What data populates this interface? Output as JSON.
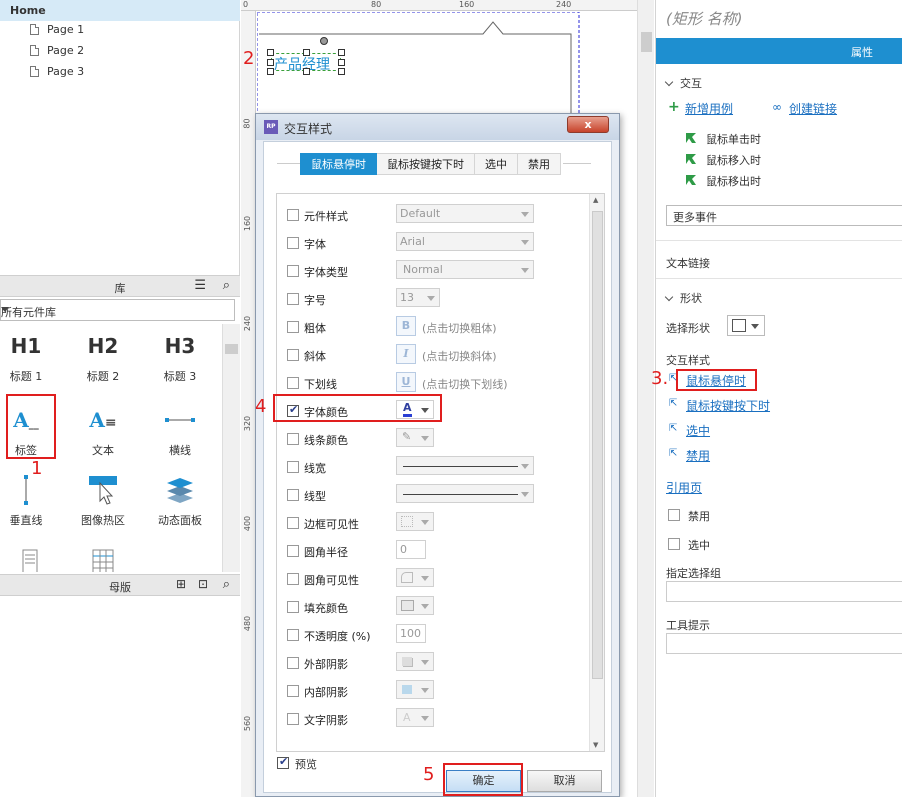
{
  "pages": {
    "home": "Home",
    "items": [
      "Page 1",
      "Page 2",
      "Page 3"
    ]
  },
  "library": {
    "title": "库",
    "selector": "所有元件库",
    "widgets": [
      {
        "glyph": "H1",
        "label": "标题 1"
      },
      {
        "glyph": "H2",
        "label": "标题 2"
      },
      {
        "glyph": "H3",
        "label": "标题 3"
      },
      {
        "glyph": "A_",
        "label": "标签"
      },
      {
        "glyph": "A≡",
        "label": "文本"
      },
      {
        "glyph": "line",
        "label": "横线"
      },
      {
        "glyph": "vline",
        "label": "垂直线"
      },
      {
        "glyph": "hotspot",
        "label": "图像热区"
      },
      {
        "glyph": "layers",
        "label": "动态面板"
      }
    ],
    "master_title": "母版"
  },
  "ruler": {
    "top": [
      "0",
      "80",
      "160",
      "240"
    ],
    "left": [
      "80",
      "160",
      "240",
      "320",
      "400",
      "480",
      "560"
    ]
  },
  "canvas": {
    "label_text": "产品经理"
  },
  "dialog": {
    "title": "交互样式",
    "icon": "RP",
    "close": "x",
    "tabs": [
      "鼠标悬停时",
      "鼠标按键按下时",
      "选中",
      "禁用"
    ],
    "rows": [
      {
        "label": "元件样式",
        "value": "Default"
      },
      {
        "label": "字体",
        "value": "Arial"
      },
      {
        "label": "字体类型",
        "value": "Normal"
      },
      {
        "label": "字号",
        "value": "13"
      },
      {
        "label": "粗体",
        "value": "B",
        "hint": "(点击切换粗体)"
      },
      {
        "label": "斜体",
        "value": "I",
        "hint": "(点击切换斜体)"
      },
      {
        "label": "下划线",
        "value": "U",
        "hint": "(点击切换下划线)"
      },
      {
        "label": "字体颜色",
        "value": "A"
      },
      {
        "label": "线条颜色"
      },
      {
        "label": "线宽"
      },
      {
        "label": "线型"
      },
      {
        "label": "边框可见性"
      },
      {
        "label": "圆角半径",
        "value": "0"
      },
      {
        "label": "圆角可见性"
      },
      {
        "label": "填充颜色"
      },
      {
        "label": "不透明度 (%)",
        "value": "100"
      },
      {
        "label": "外部阴影"
      },
      {
        "label": "内部阴影"
      },
      {
        "label": "文字阴影",
        "value": "A"
      }
    ],
    "preview": "预览",
    "ok": "确定",
    "cancel": "取消"
  },
  "inspector": {
    "title": "(矩形 名称)",
    "tab": "属性",
    "interaction": "交互",
    "add_case": "新增用例",
    "create_link": "创建链接",
    "events": [
      "鼠标单击时",
      "鼠标移入时",
      "鼠标移出时"
    ],
    "more_events": "更多事件",
    "text_link": "文本链接",
    "shape": "形状",
    "select_shape": "选择形状",
    "interaction_styles": "交互样式",
    "style_links": [
      "鼠标悬停时",
      "鼠标按键按下时",
      "选中",
      "禁用"
    ],
    "reference_page": "引用页",
    "disabled": "禁用",
    "selected": "选中",
    "selection_group": "指定选择组",
    "tooltip": "工具提示"
  },
  "annotations": [
    "1",
    "2",
    "3.",
    "4",
    "5"
  ],
  "colors": {
    "accent": "#1e8fd0",
    "annotation": "#e01e1e",
    "link": "#1a6fc0"
  }
}
